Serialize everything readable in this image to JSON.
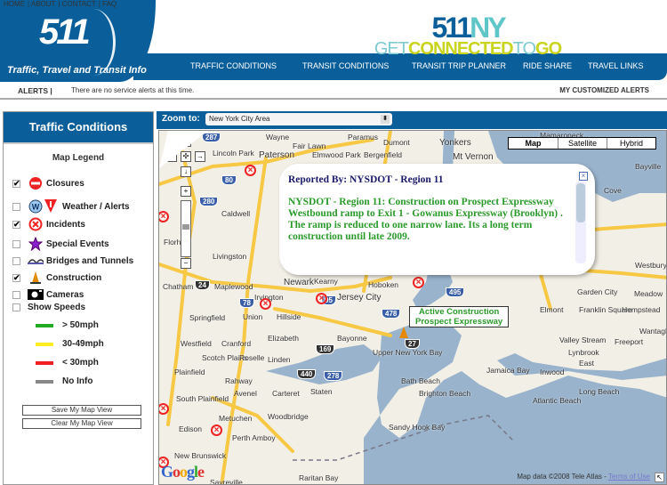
{
  "top_links": [
    "HOME",
    "ABOUT",
    "CONTACT",
    "FAQ"
  ],
  "header": {
    "logo": "511",
    "tagline": "Traffic, Travel and Transit Info",
    "brand_num": "511",
    "brand_ny": "NY",
    "brand_get": "GET",
    "brand_connected": "CONNECTED",
    "brand_to": "TO",
    "brand_go": "GO"
  },
  "nav": [
    "TRAFFIC CONDITIONS",
    "TRANSIT CONDITIONS",
    "TRANSIT TRIP PLANNER",
    "RIDE SHARE",
    "TRAVEL LINKS"
  ],
  "alerts": {
    "label": "ALERTS |",
    "message": "There are no service alerts at this time.",
    "custom": "MY CUSTOMIZED ALERTS"
  },
  "sidebar": {
    "title": "Traffic Conditions",
    "legend_title": "Map Legend",
    "items": [
      {
        "label": "Closures",
        "checked": true,
        "icon": "closure-icon"
      },
      {
        "label": "Weather / Alerts",
        "checked": false,
        "icon": "weather-icon"
      },
      {
        "label": "Incidents",
        "checked": true,
        "icon": "incident-icon"
      },
      {
        "label": "Special Events",
        "checked": false,
        "icon": "star-icon"
      },
      {
        "label": "Bridges and Tunnels",
        "checked": false,
        "icon": "bridge-icon"
      },
      {
        "label": "Construction",
        "checked": true,
        "icon": "cone-icon"
      },
      {
        "label": "Cameras",
        "checked": false,
        "icon": "camera-icon"
      },
      {
        "label": "Show Speeds",
        "checked": false
      }
    ],
    "speeds": [
      {
        "label": "> 50mph",
        "color": "#22aa22"
      },
      {
        "label": "30-49mph",
        "color": "#ffee22"
      },
      {
        "label": "< 30mph",
        "color": "#ee2222"
      },
      {
        "label": "No Info",
        "color": "#888888"
      }
    ],
    "save_btn": "Save My Map View",
    "clear_btn": "Clear My Map View"
  },
  "map": {
    "zoom_label": "Zoom to:",
    "zoom_value": "New York City Area",
    "types": [
      "Map",
      "Satellite",
      "Hybrid"
    ],
    "places": [
      "Wayne",
      "Paramus",
      "Dumont",
      "Yonkers",
      "Mamaroneck",
      "Lincoln Park",
      "Paterson",
      "Fair Lawn",
      "Elmwood Park",
      "Bergenfield",
      "Mt Vernon",
      "Bayville",
      "Cove",
      "Caldwell",
      "Westbury",
      "Florham",
      "Livingston",
      "Chatham",
      "Maplewood",
      "Newark",
      "Kearny",
      "Hoboken",
      "Garden City",
      "Meadow",
      "Irvington",
      "Jersey City",
      "Elmont",
      "Franklin Square",
      "Hempstead",
      "Springfield",
      "Union",
      "Hillside",
      "Elizabeth",
      "Bayonne",
      "Valley Stream",
      "Freeport",
      "Wantagh",
      "Westfield",
      "Cranford",
      "Upper New York Bay",
      "Scotch Plains",
      "Roselle",
      "Linden",
      "Lynbrook",
      "Plainfield",
      "Rahway",
      "Jamaica Bay",
      "Inwood",
      "East",
      "Long Beach",
      "Bath Beach",
      "Avenel",
      "Carteret",
      "Staten",
      "Brighton Beach",
      "Atlantic Beach",
      "South Plainfield",
      "Metuchen",
      "Woodbridge",
      "Sandy Hook Bay",
      "Edison",
      "Perth Amboy",
      "New Brunswick",
      "Raritan Bay",
      "Sayreville",
      "Tele"
    ],
    "shields": [
      "287",
      "80",
      "280",
      "24",
      "78",
      "95",
      "278",
      "440",
      "478",
      "495",
      "169",
      "27"
    ],
    "popup": {
      "reported_by": "Reported By: NYSDOT - Region 11",
      "description": "NYSDOT - Region 11: Construction on Prospect Expressway Westbound ramp to Exit 1 - Gowanus Expressway (Brooklyn) . The ramp is reduced to one narrow lane. Its a long term construction until late 2009."
    },
    "tooltip_line1": "Active Construction",
    "tooltip_line2": "Prospect Expressway",
    "copyright": "Map data ©2008 Tele Atlas - ",
    "terms": "Terms of Use",
    "google": "Google",
    "colors": {
      "water": "#99b3cc",
      "land": "#f2efe6",
      "road": "#f7c843",
      "header": "#0a5f9a"
    }
  }
}
